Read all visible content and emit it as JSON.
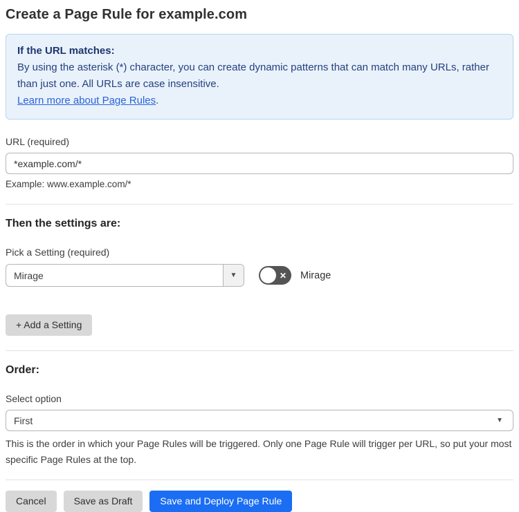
{
  "page": {
    "title": "Create a Page Rule for example.com"
  },
  "info_box": {
    "heading": "If the URL matches:",
    "body": "By using the asterisk (*) character, you can create dynamic patterns that can match many URLs, rather than just one. All URLs are case insensitive.",
    "link_label": "Learn more about Page Rules",
    "link_suffix": "."
  },
  "url_field": {
    "label": "URL (required)",
    "value": "*example.com/*",
    "helper": "Example: www.example.com/*"
  },
  "settings_section": {
    "heading": "Then the settings are:",
    "picker_label": "Pick a Setting (required)",
    "selected_setting": "Mirage",
    "toggle": {
      "state": "off",
      "state_glyph": "✕",
      "label": "Mirage"
    },
    "add_button_label": "+ Add a Setting"
  },
  "order_section": {
    "heading": "Order:",
    "label": "Select option",
    "selected_option": "First",
    "helper": "This is the order in which your Page Rules will be triggered. Only one Page Rule will trigger per URL, so put your most specific Page Rules at the top."
  },
  "footer": {
    "cancel_label": "Cancel",
    "save_draft_label": "Save as Draft",
    "save_deploy_label": "Save and Deploy Page Rule"
  },
  "icons": {
    "dropdown_caret": "▼"
  },
  "colors": {
    "info_box_bg": "#e9f2fb",
    "info_box_border": "#b9d4ee",
    "info_text": "#25407e",
    "link_blue": "#2b62d9",
    "primary_button_blue": "#1b6ef3",
    "gray_button_bg": "#d8d8d8",
    "toggle_off_bg": "#545454"
  }
}
